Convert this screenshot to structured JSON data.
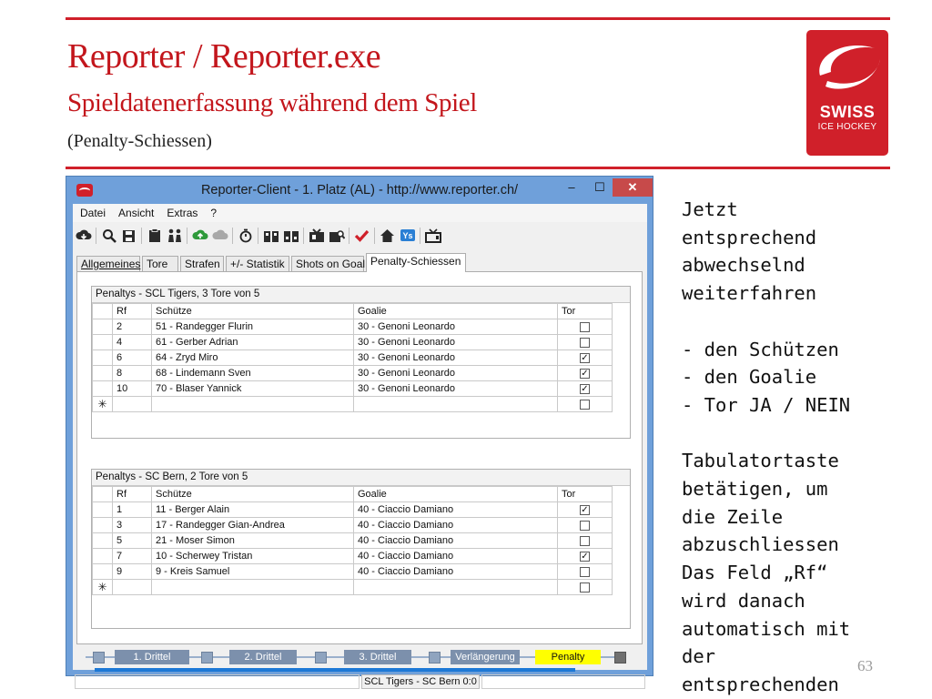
{
  "slide": {
    "title": "Reporter / Reporter.exe",
    "subtitle": "Spieldatenerfassung während dem Spiel",
    "subsubtitle": "(Penalty-Schiessen)",
    "page_number": "63",
    "note": "Jetzt\nentsprechend\nabwechselnd\nweiterfahren\n\n- den Schützen\n- den Goalie\n- Tor JA / NEIN\n\nTabulatortaste\nbetätigen, um\ndie Zeile\nabzuschliessen\nDas Feld „Rf“\nwird danach\nautomatisch mit\nder\nentsprechenden",
    "logo": {
      "line1": "SWISS",
      "line2": "ICE HOCKEY"
    },
    "accent_color": "#d0202a"
  },
  "window": {
    "title": "Reporter-Client  -  1. Platz (AL)  -  http://www.reporter.ch/",
    "minimize": "–",
    "maximize": "☐",
    "close": "✕",
    "menu": [
      "Datei",
      "Ansicht",
      "Extras",
      "?"
    ],
    "toolbar_icons": [
      "download-cloud-icon",
      "search-icon",
      "save-icon",
      "clipboard-icon",
      "players-icon",
      "upload-cloud-icon",
      "cloud-disabled-icon",
      "stopwatch-icon",
      "lineup-icon",
      "lineup-alt-icon",
      "team-icon",
      "team-search-icon",
      "checkmark-icon",
      "home-icon",
      "yes-badge-icon",
      "tv-icon"
    ],
    "tabs": [
      "Allgemeines",
      "Tore",
      "Strafen",
      "+/- Statistik",
      "Shots on Goal",
      "Penalty-Schiessen"
    ],
    "active_tab": "Penalty-Schiessen",
    "columns": {
      "rf": "Rf",
      "shooter": "Schütze",
      "goalie": "Goalie",
      "goal": "Tor"
    },
    "new_row_marker": "✳",
    "section1": {
      "header": "Penaltys - SCL Tigers, 3 Tore von 5",
      "rows": [
        {
          "rf": "2",
          "shooter": "51 - Randegger Flurin",
          "goalie": "30 - Genoni Leonardo",
          "goal": false
        },
        {
          "rf": "4",
          "shooter": "61 - Gerber Adrian",
          "goalie": "30 - Genoni Leonardo",
          "goal": false
        },
        {
          "rf": "6",
          "shooter": "64 - Zryd Miro",
          "goalie": "30 - Genoni Leonardo",
          "goal": true
        },
        {
          "rf": "8",
          "shooter": "68 - Lindemann Sven",
          "goalie": "30 - Genoni Leonardo",
          "goal": true
        },
        {
          "rf": "10",
          "shooter": "70 - Blaser Yannick",
          "goalie": "30 - Genoni Leonardo",
          "goal": true
        }
      ]
    },
    "section2": {
      "header": "Penaltys - SC Bern, 2 Tore von 5",
      "rows": [
        {
          "rf": "1",
          "shooter": "11 - Berger Alain",
          "goalie": "40 - Ciaccio Damiano",
          "goal": true
        },
        {
          "rf": "3",
          "shooter": "17 - Randegger Gian-Andrea",
          "goalie": "40 - Ciaccio Damiano",
          "goal": false
        },
        {
          "rf": "5",
          "shooter": "21 - Moser Simon",
          "goalie": "40 - Ciaccio Damiano",
          "goal": false
        },
        {
          "rf": "7",
          "shooter": "10 - Scherwey Tristan",
          "goalie": "40 - Ciaccio Damiano",
          "goal": true
        },
        {
          "rf": "9",
          "shooter": "9 - Kreis Samuel",
          "goalie": "40 - Ciaccio Damiano",
          "goal": false
        }
      ]
    },
    "periods": [
      "1. Drittel",
      "2. Drittel",
      "3. Drittel",
      "Verlängerung",
      "Penalty"
    ],
    "active_period": "Penalty",
    "active_period_color": "#ffff00",
    "status": "SCL Tigers - SC Bern 0:0"
  }
}
